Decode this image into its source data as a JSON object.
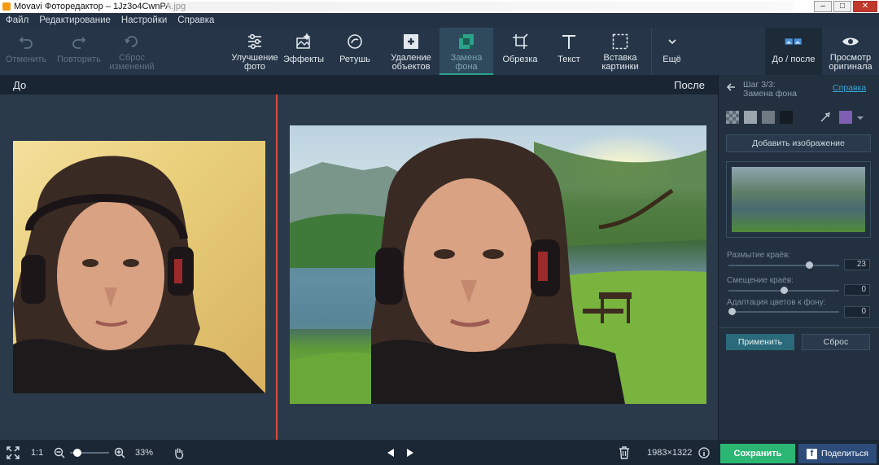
{
  "window": {
    "title": "Movavi Фоторедактор – 1Jz3o4CwnPA.jpg"
  },
  "menu": {
    "items": [
      "Файл",
      "Редактирование",
      "Настройки",
      "Справка"
    ]
  },
  "toolbar": {
    "undo": "Отменить",
    "redo": "Повторить",
    "reset_line1": "Сброс",
    "reset_line2": "изменений",
    "enhance_line1": "Улучшение",
    "enhance_line2": "фото",
    "effects": "Эффекты",
    "retouch": "Ретушь",
    "remove_line1": "Удаление",
    "remove_line2": "объектов",
    "bg_line1": "Замена",
    "bg_line2": "фона",
    "crop": "Обрезка",
    "text": "Текст",
    "insert_line1": "Вставка",
    "insert_line2": "картинки",
    "more": "Ещё",
    "before_after": "До / после",
    "preview_line1": "Просмотр",
    "preview_line2": "оригинала"
  },
  "view": {
    "before_label": "До",
    "after_label": "После"
  },
  "panel": {
    "step": "Шаг 3/3:",
    "step_title": "Замена фона",
    "help": "Справка",
    "add_image": "Добавить изображение",
    "edge_blur_label": "Размытие краёв:",
    "edge_blur_value": "23",
    "edge_blur_level": 0.75,
    "edge_shift_label": "Смещение краёв:",
    "edge_shift_value": "0",
    "edge_shift_level": 0.5,
    "color_adapt_label": "Адаптация цветов к фону:",
    "color_adapt_value": "0",
    "color_adapt_level": 0.0,
    "apply": "Применить",
    "reset": "Сброс",
    "swatch_colors": [
      "#9aa5ae",
      "#6f7a83",
      "#141b22",
      "#7e5fb3"
    ]
  },
  "bottom": {
    "zoom_ratio": "1:1",
    "zoom_percent": "33%",
    "zoom_level": 0.1,
    "dimensions": "1983×1322",
    "save": "Сохранить",
    "share": "Поделиться"
  },
  "colors": {
    "accent": "#2aa38a",
    "save": "#2bb673",
    "divider": "#d9503c"
  }
}
